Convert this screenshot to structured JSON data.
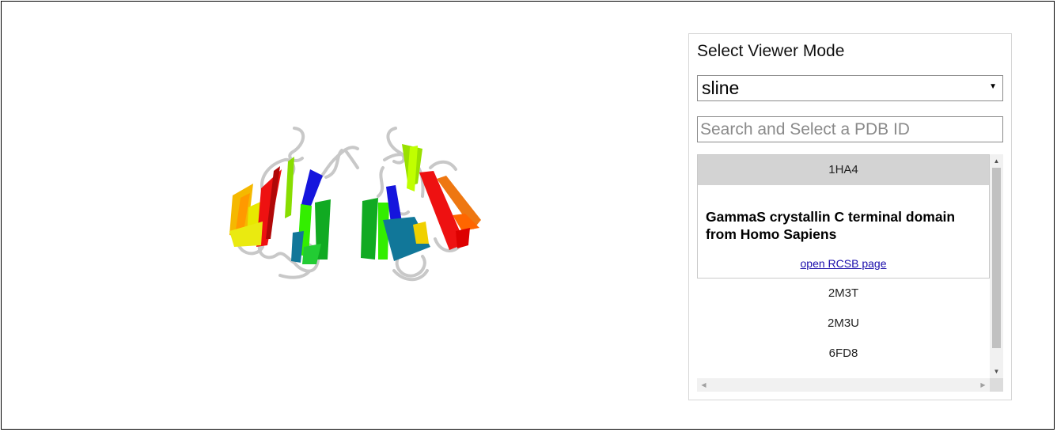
{
  "panel": {
    "title": "Select Viewer Mode",
    "mode_value": "sline",
    "search_placeholder": "Search and Select a PDB ID"
  },
  "results": {
    "selected": {
      "id": "1HA4",
      "description": "GammaS crystallin C terminal domain from Homo Sapiens",
      "link_label": "open RCSB page"
    },
    "others": [
      "2M3T",
      "2M3U",
      "6FD8"
    ]
  },
  "icons": {
    "dropdown": "caret-down-icon",
    "scroll_up": "scroll-up-arrow-icon",
    "scroll_down": "scroll-down-arrow-icon",
    "scroll_left": "scroll-left-arrow-icon",
    "scroll_right": "scroll-right-arrow-icon"
  },
  "colors": {
    "selected_header": "#d3d3d3",
    "link": "#1a0dab",
    "ribbon_red": "#ee1111",
    "ribbon_orange": "#ee7711",
    "ribbon_yellow": "#f0d000",
    "ribbon_green": "#11aa22",
    "ribbon_blue": "#1515dd",
    "ribbon_teal": "#117799",
    "coil": "#c8c8c8"
  }
}
